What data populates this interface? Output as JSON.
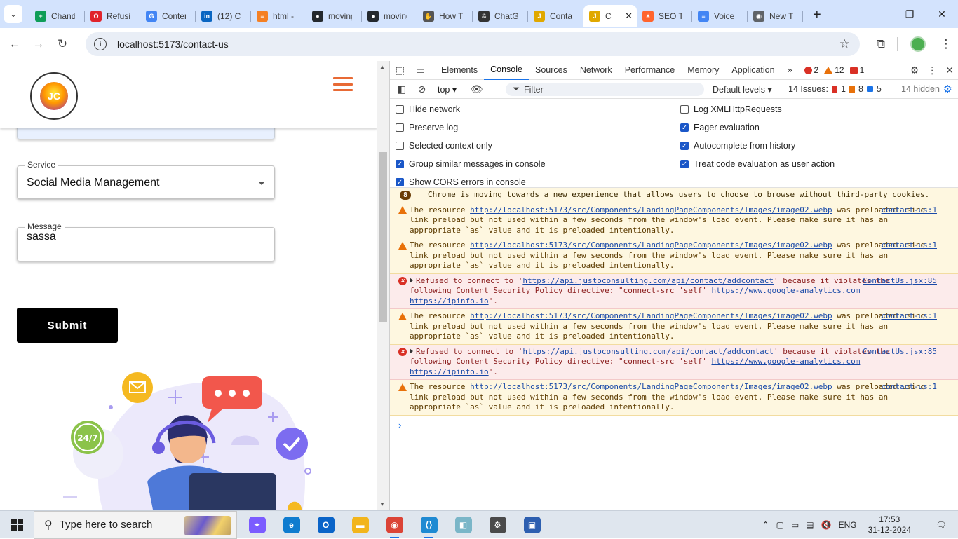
{
  "tabs": [
    {
      "label": "Chandi",
      "favicon": "sheets-icon",
      "color": "#0f9d58",
      "glyph": "+"
    },
    {
      "label": "Refusing",
      "favicon": "opera-icon",
      "color": "#e0242c",
      "glyph": "O"
    },
    {
      "label": "Content",
      "favicon": "google-icon",
      "color": "#4285f4",
      "glyph": "G"
    },
    {
      "label": "(12) C",
      "favicon": "linkedin-icon",
      "color": "#0a66c2",
      "glyph": "in"
    },
    {
      "label": "html -",
      "favicon": "stackoverflow-icon",
      "color": "#f48024",
      "glyph": "≡"
    },
    {
      "label": "moving",
      "favicon": "github-icon",
      "color": "#24292e",
      "glyph": "●"
    },
    {
      "label": "moving",
      "favicon": "github-icon",
      "color": "#24292e",
      "glyph": "●"
    },
    {
      "label": "How T",
      "favicon": "handshake-icon",
      "color": "#555555",
      "glyph": "✋"
    },
    {
      "label": "ChatG",
      "favicon": "chatgpt-icon",
      "color": "#333333",
      "glyph": "✲"
    },
    {
      "label": "Conta",
      "favicon": "justo-icon",
      "color": "#e0a800",
      "glyph": "J"
    },
    {
      "label": "C",
      "favicon": "justo-icon",
      "color": "#e0a800",
      "glyph": "J",
      "active": true
    },
    {
      "label": "SEO T",
      "favicon": "semrush-icon",
      "color": "#ff642d",
      "glyph": "✶"
    },
    {
      "label": "Voice",
      "favicon": "docs-icon",
      "color": "#4285f4",
      "glyph": "≡"
    },
    {
      "label": "New T",
      "favicon": "chrome-icon",
      "color": "#5f6368",
      "glyph": "◉"
    }
  ],
  "browser": {
    "url": "localhost:5173/contact-us"
  },
  "form": {
    "service_label": "Service",
    "service_value": "Social Media Management",
    "message_label": "Message",
    "message_value": "sassa",
    "submit_label": "Submit"
  },
  "devtools": {
    "tabs": [
      "Elements",
      "Console",
      "Sources",
      "Network",
      "Performance",
      "Memory",
      "Application"
    ],
    "active_tab": "Console",
    "badge_errors": "2",
    "badge_warnings": "12",
    "badge_info": "1",
    "context": "top",
    "filter_placeholder": "Filter",
    "levels": "Default levels",
    "issues_label": "14 Issues:",
    "issues_errors": "1",
    "issues_warnings": "8",
    "issues_info": "5",
    "hidden": "14 hidden",
    "options_left": [
      {
        "label": "Hide network",
        "checked": false
      },
      {
        "label": "Preserve log",
        "checked": false
      },
      {
        "label": "Selected context only",
        "checked": false
      },
      {
        "label": "Group similar messages in console",
        "checked": true
      },
      {
        "label": "Show CORS errors in console",
        "checked": true
      }
    ],
    "options_right": [
      {
        "label": "Log XMLHttpRequests",
        "checked": false
      },
      {
        "label": "Eager evaluation",
        "checked": true
      },
      {
        "label": "Autocomplete from history",
        "checked": true
      },
      {
        "label": "Treat code evaluation as user action",
        "checked": true
      }
    ],
    "messages": [
      {
        "kind": "info",
        "count": "8",
        "text": "Chrome is moving towards a new experience that allows users to choose to browse without third-party cookies."
      },
      {
        "kind": "warn",
        "pre": "The resource ",
        "link": "http://localhost:5173/src/Components/LandingPageComponents/Images/image02.webp",
        "post": " was preloaded using link preload but not used within a few seconds from the window's load event. Please make sure it has an appropriate `as` value and it is preloaded intentionally.",
        "source": "contact-us:1"
      },
      {
        "kind": "warn",
        "pre": "The resource ",
        "link": "http://localhost:5173/src/Components/LandingPageComponents/Images/image02.webp",
        "post": " was preloaded using link preload but not used within a few seconds from the window's load event. Please make sure it has an appropriate `as` value and it is preloaded intentionally.",
        "source": "contact-us:1"
      },
      {
        "kind": "err",
        "pre": "Refused to connect to '",
        "link": "https://api.justoconsulting.com/api/contact/addcontact",
        "post": "' because it violates the following Content Security Policy directive: \"connect-src 'self' ",
        "link2": "https://www.google-analytics.com",
        "link3": "https://ipinfo.io",
        "tail": "\".",
        "source": "ContactUs.jsx:85"
      },
      {
        "kind": "warn",
        "pre": "The resource ",
        "link": "http://localhost:5173/src/Components/LandingPageComponents/Images/image02.webp",
        "post": " was preloaded using link preload but not used within a few seconds from the window's load event. Please make sure it has an appropriate `as` value and it is preloaded intentionally.",
        "source": "contact-us:1"
      },
      {
        "kind": "err",
        "pre": "Refused to connect to '",
        "link": "https://api.justoconsulting.com/api/contact/addcontact",
        "post": "' because it violates the following Content Security Policy directive: \"connect-src 'self' ",
        "link2": "https://www.google-analytics.com",
        "link3": "https://ipinfo.io",
        "tail": "\".",
        "source": "ContactUs.jsx:85"
      },
      {
        "kind": "warn",
        "pre": "The resource ",
        "link": "http://localhost:5173/src/Components/LandingPageComponents/Images/image02.webp",
        "post": " was preloaded using link preload but not used within a few seconds from the window's load event. Please make sure it has an appropriate `as` value and it is preloaded intentionally.",
        "source": "contact-us:1"
      }
    ]
  },
  "taskbar": {
    "search_placeholder": "Type here to search",
    "language": "ENG",
    "time": "17:53",
    "date": "31-12-2024",
    "apps": [
      {
        "name": "copilot-icon",
        "color": "#7b5cff",
        "glyph": "✦"
      },
      {
        "name": "edge-icon",
        "color": "#0f7ccf",
        "glyph": "e"
      },
      {
        "name": "outlook-icon",
        "color": "#0a64c8",
        "glyph": "O"
      },
      {
        "name": "file-explorer-icon",
        "color": "#f2b51c",
        "glyph": "▬"
      },
      {
        "name": "chrome-icon",
        "color": "#db4437",
        "glyph": "◉",
        "running": true
      },
      {
        "name": "vscode-icon",
        "color": "#1f8ad2",
        "glyph": "⟨⟩",
        "running": true
      },
      {
        "name": "files-icon",
        "color": "#7ab6c8",
        "glyph": "◧"
      },
      {
        "name": "settings-icon",
        "color": "#4a4a4a",
        "glyph": "⚙"
      },
      {
        "name": "remote-app-icon",
        "color": "#2d5fb0",
        "glyph": "▣"
      }
    ]
  }
}
